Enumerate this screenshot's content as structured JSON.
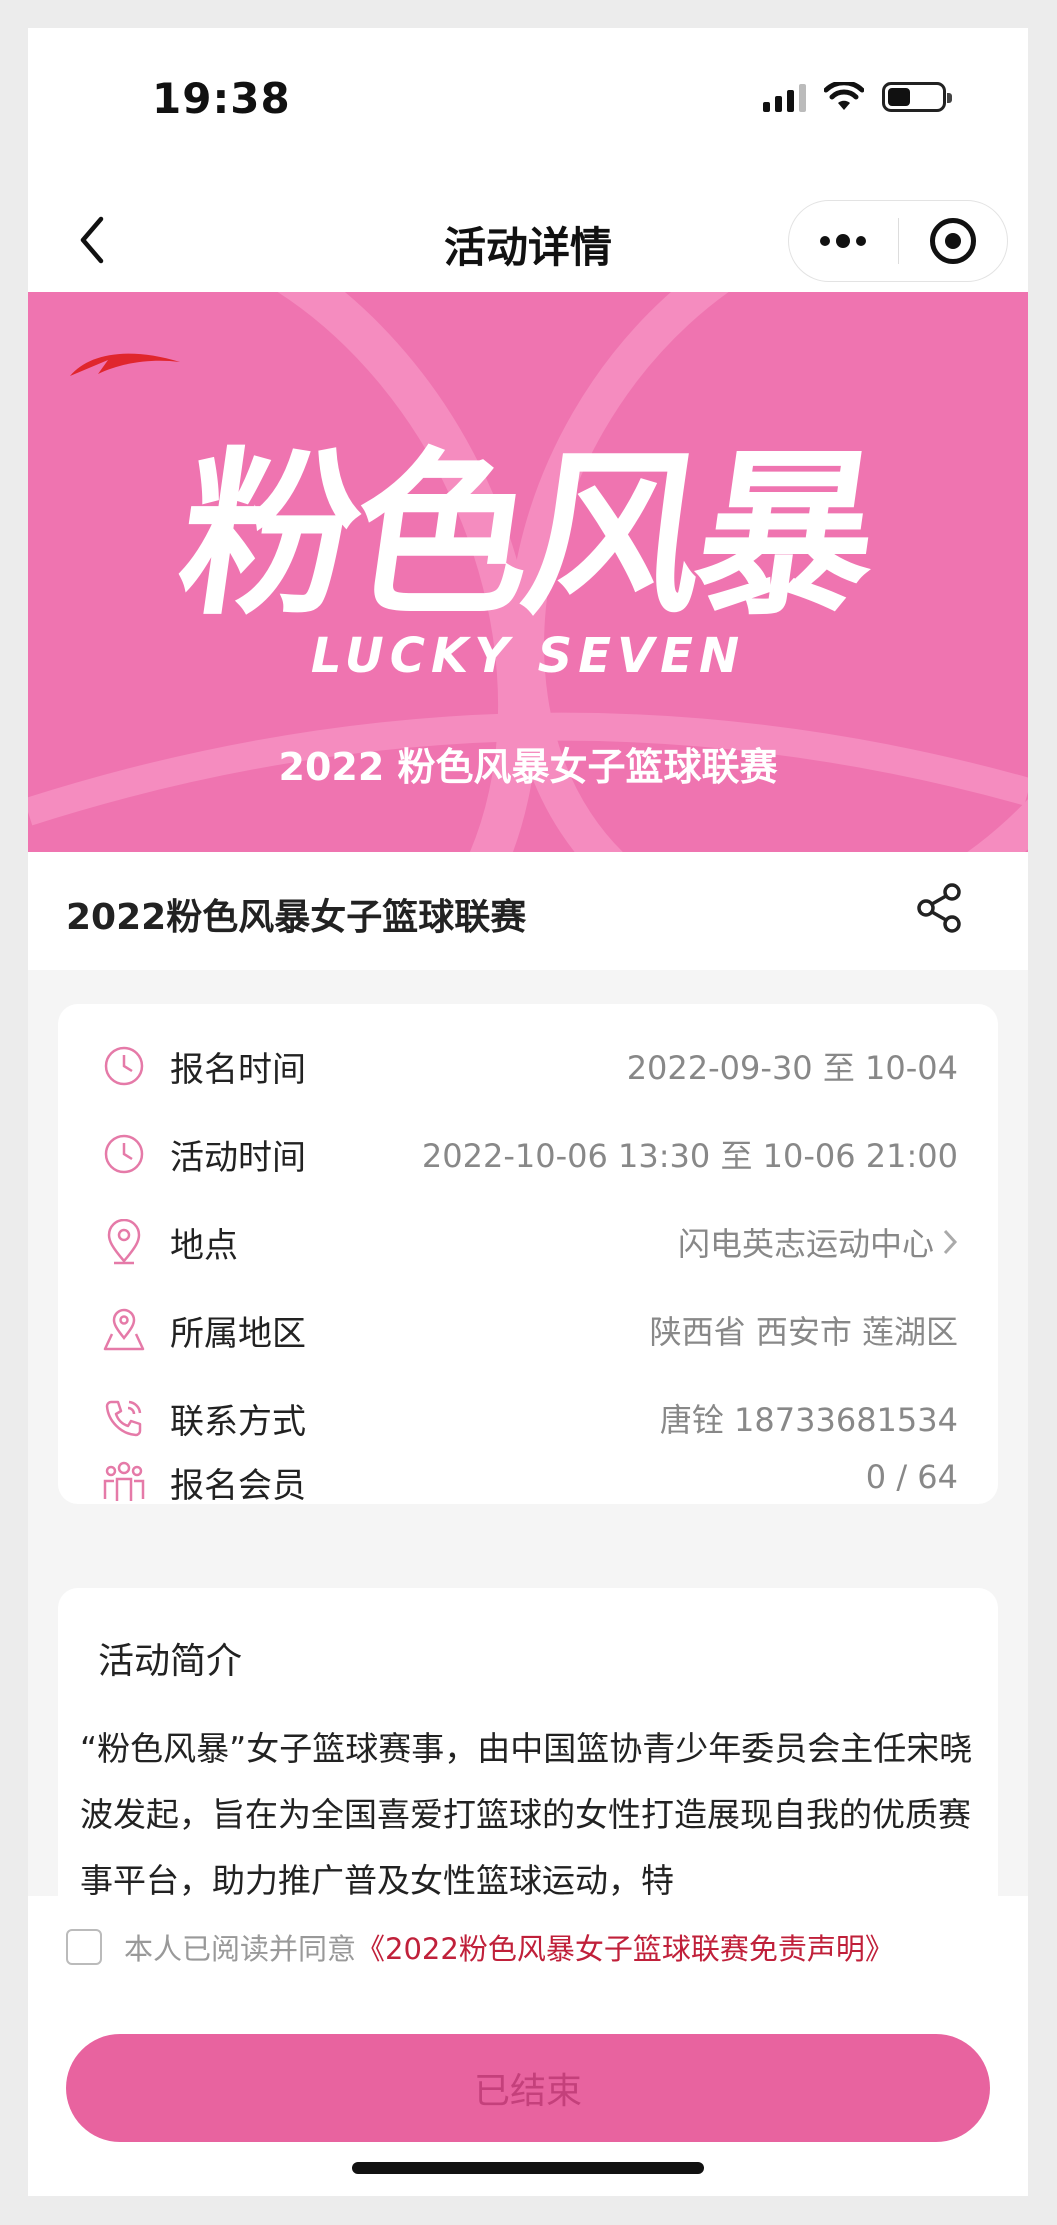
{
  "status_bar": {
    "time": "19:38"
  },
  "nav": {
    "title": "活动详情"
  },
  "banner": {
    "title": "粉色风暴",
    "subtitle_en": "LUCKY SEVEN",
    "subtitle": "2022 粉色风暴女子篮球联赛",
    "brand_color": "#ef74b0"
  },
  "event": {
    "title": "2022粉色风暴女子篮球联赛"
  },
  "info": [
    {
      "icon": "clock-icon",
      "label": "报名时间",
      "value": "2022-09-30 至 10-04"
    },
    {
      "icon": "clock-icon",
      "label": "活动时间",
      "value": "2022-10-06 13:30 至 10-06 21:00"
    },
    {
      "icon": "location-pin-icon",
      "label": "地点",
      "value": "闪电英志运动中心"
    },
    {
      "icon": "map-pin-icon",
      "label": "所属地区",
      "value": "陕西省 西安市 莲湖区"
    },
    {
      "icon": "phone-icon",
      "label": "联系方式",
      "value": "唐铨 18733681534"
    },
    {
      "icon": "members-icon",
      "label": "报名会员",
      "value": "0 / 64"
    }
  ],
  "intro": {
    "heading": "活动简介",
    "text": "“粉色风暴”女子篮球赛事，由中国篮协青少年委员会主任宋晓波发起，旨在为全国喜爱打篮球的女性打造展现自我的优质赛事平台，助力推广普及女性篮球运动，特"
  },
  "agreement": {
    "checked": false,
    "text": "本人已阅读并同意",
    "link": "《2022粉色风暴女子篮球联赛免责声明》"
  },
  "action": {
    "label": "已结束"
  },
  "colors": {
    "accent": "#e8639f",
    "link": "#c0203a",
    "icon": "#e57aa8"
  }
}
